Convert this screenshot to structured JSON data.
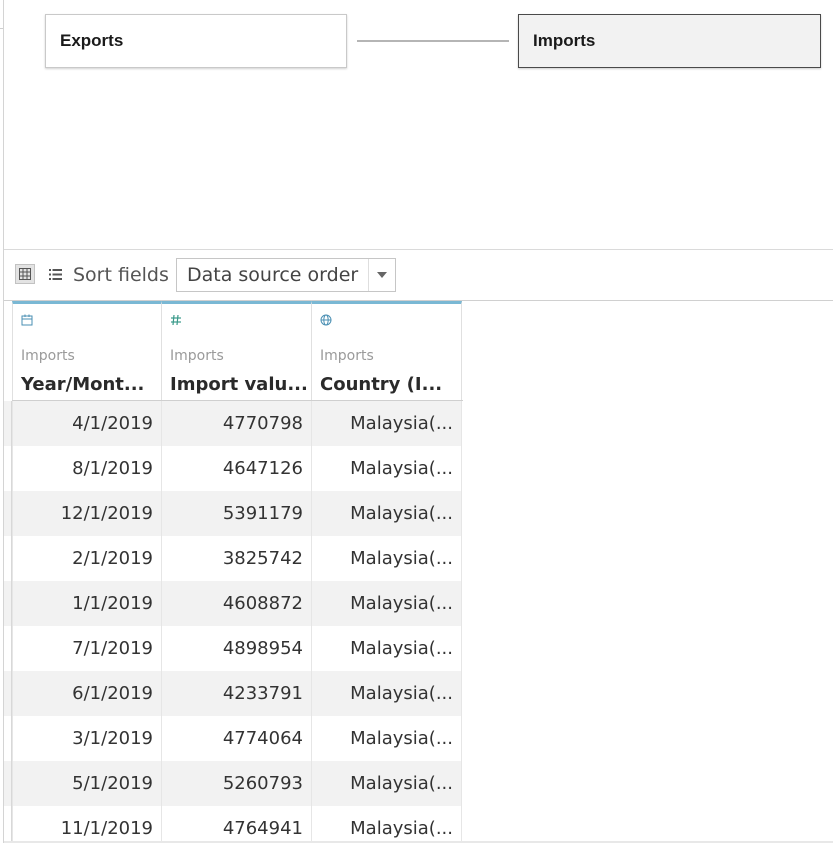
{
  "relationship_canvas": {
    "left_table": {
      "name": "Exports"
    },
    "right_table": {
      "name": "Imports"
    }
  },
  "toolbar": {
    "grid_view_icon": "grid-icon",
    "list_view_icon": "list-icon",
    "sort_label": "Sort fields",
    "sort_selected": "Data source order"
  },
  "colors": {
    "header_accent": "#7ab8d4",
    "row_stripe": "#f2f2f2",
    "imports_node_bg": "#f2f2f2"
  },
  "columns": [
    {
      "type_icon": "calendar-icon",
      "source": "Imports",
      "name": "Year/Mont..."
    },
    {
      "type_icon": "number-icon",
      "source": "Imports",
      "name": "Import valu..."
    },
    {
      "type_icon": "globe-icon",
      "source": "Imports",
      "name": "Country (I..."
    }
  ],
  "rows": [
    [
      "4/1/2019",
      "4770798",
      "Malaysia(..."
    ],
    [
      "8/1/2019",
      "4647126",
      "Malaysia(..."
    ],
    [
      "12/1/2019",
      "5391179",
      "Malaysia(..."
    ],
    [
      "2/1/2019",
      "3825742",
      "Malaysia(..."
    ],
    [
      "1/1/2019",
      "4608872",
      "Malaysia(..."
    ],
    [
      "7/1/2019",
      "4898954",
      "Malaysia(..."
    ],
    [
      "6/1/2019",
      "4233791",
      "Malaysia(..."
    ],
    [
      "3/1/2019",
      "4774064",
      "Malaysia(..."
    ],
    [
      "5/1/2019",
      "5260793",
      "Malaysia(..."
    ],
    [
      "11/1/2019",
      "4764941",
      "Malaysia(..."
    ]
  ]
}
